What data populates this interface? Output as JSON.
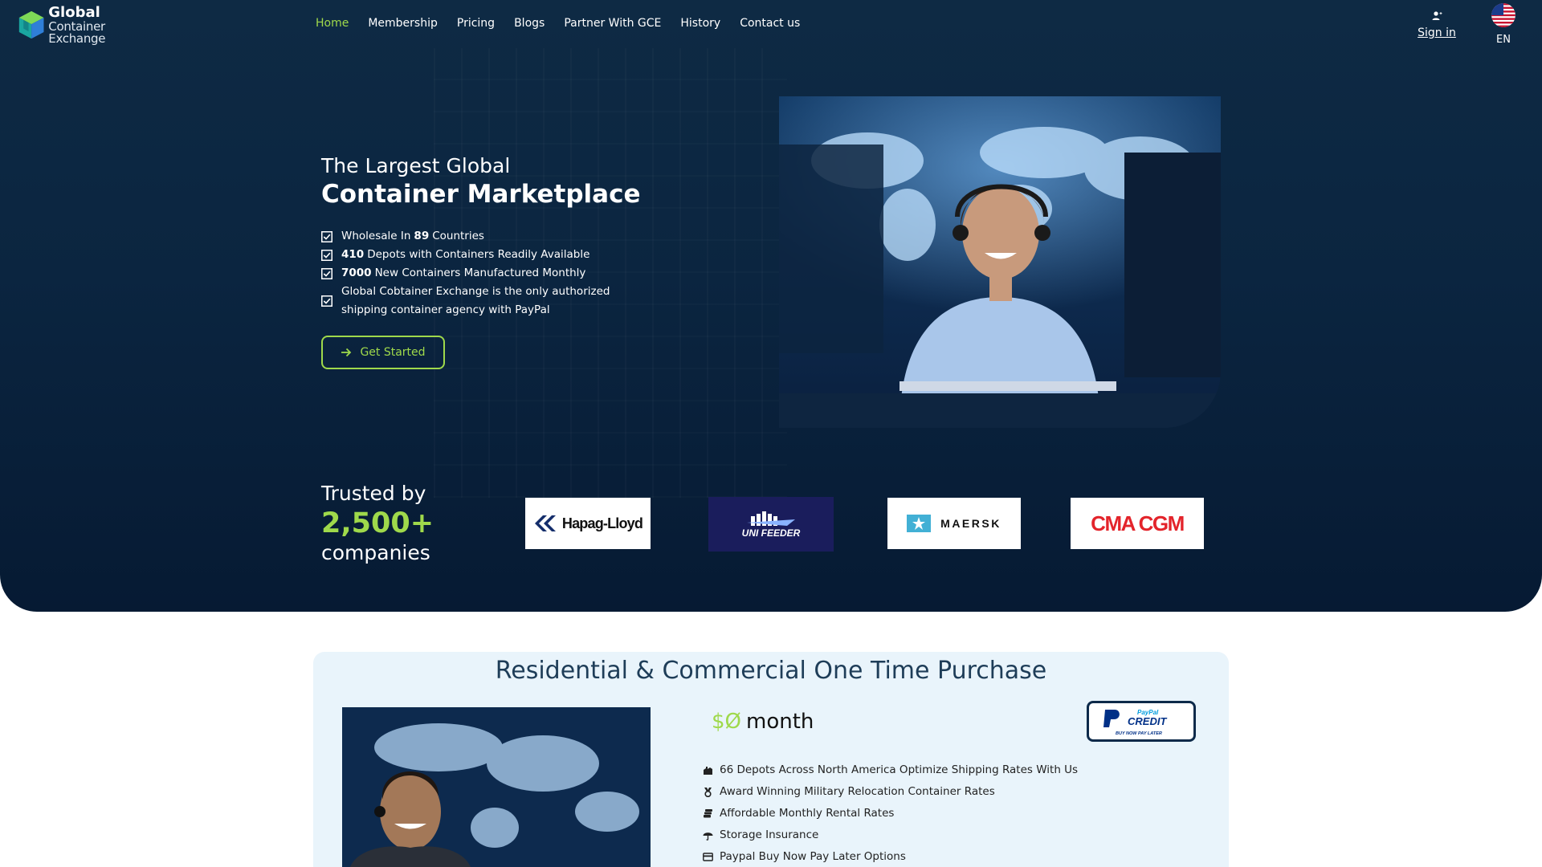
{
  "brand": {
    "title": "Global",
    "subtitle": "Container Exchange"
  },
  "nav": {
    "items": [
      {
        "label": "Home",
        "active": true
      },
      {
        "label": "Membership"
      },
      {
        "label": "Pricing"
      },
      {
        "label": "Blogs"
      },
      {
        "label": "Partner With GCE"
      },
      {
        "label": "History"
      },
      {
        "label": "Contact us"
      }
    ],
    "signin_label": "Sign in",
    "lang_label": "EN"
  },
  "hero": {
    "subtitle": "The Largest Global",
    "title": "Container Marketplace",
    "features": [
      {
        "pre": "Wholesale In",
        "bold": "89",
        "post": "Countries"
      },
      {
        "bold": "410",
        "post": "Depots with Containers Readily Available"
      },
      {
        "bold": "7000",
        "post": "New Containers Manufactured Monthly"
      },
      {
        "text": "Global Cobtainer Exchange is the only authorized shipping container agency with PayPal"
      }
    ],
    "cta_label": "Get Started"
  },
  "trusted": {
    "label": "Trusted by",
    "count": "2,500+",
    "suffix": "companies",
    "partners": [
      "Hapag-Lloyd",
      "UNI FEEDER",
      "MAERSK",
      "CMA CGM"
    ]
  },
  "plan": {
    "title": "Residential & Commercial One Time Purchase",
    "price_amount": "$Ø",
    "price_unit": "month",
    "paypal_line1": "PayPal",
    "paypal_line2": "CREDIT",
    "paypal_line3": "BUY NOW PAY LATER",
    "features": [
      {
        "icon": "depot-icon",
        "text": "66 Depots Across North America Optimize Shipping Rates With Us"
      },
      {
        "icon": "medal-icon",
        "text": "Award Winning Military Relocation Container Rates"
      },
      {
        "icon": "coins-icon",
        "text": "Affordable Monthly Rental Rates"
      },
      {
        "icon": "umbrella-icon",
        "text": "Storage Insurance"
      },
      {
        "icon": "card-icon",
        "text": "Paypal Buy Now Pay Later Options"
      }
    ]
  },
  "colors": {
    "accent": "#9fd94b",
    "hero_bg": "#0b2540",
    "title": "#1e3d58",
    "card_bg": "#e9f4fb"
  }
}
